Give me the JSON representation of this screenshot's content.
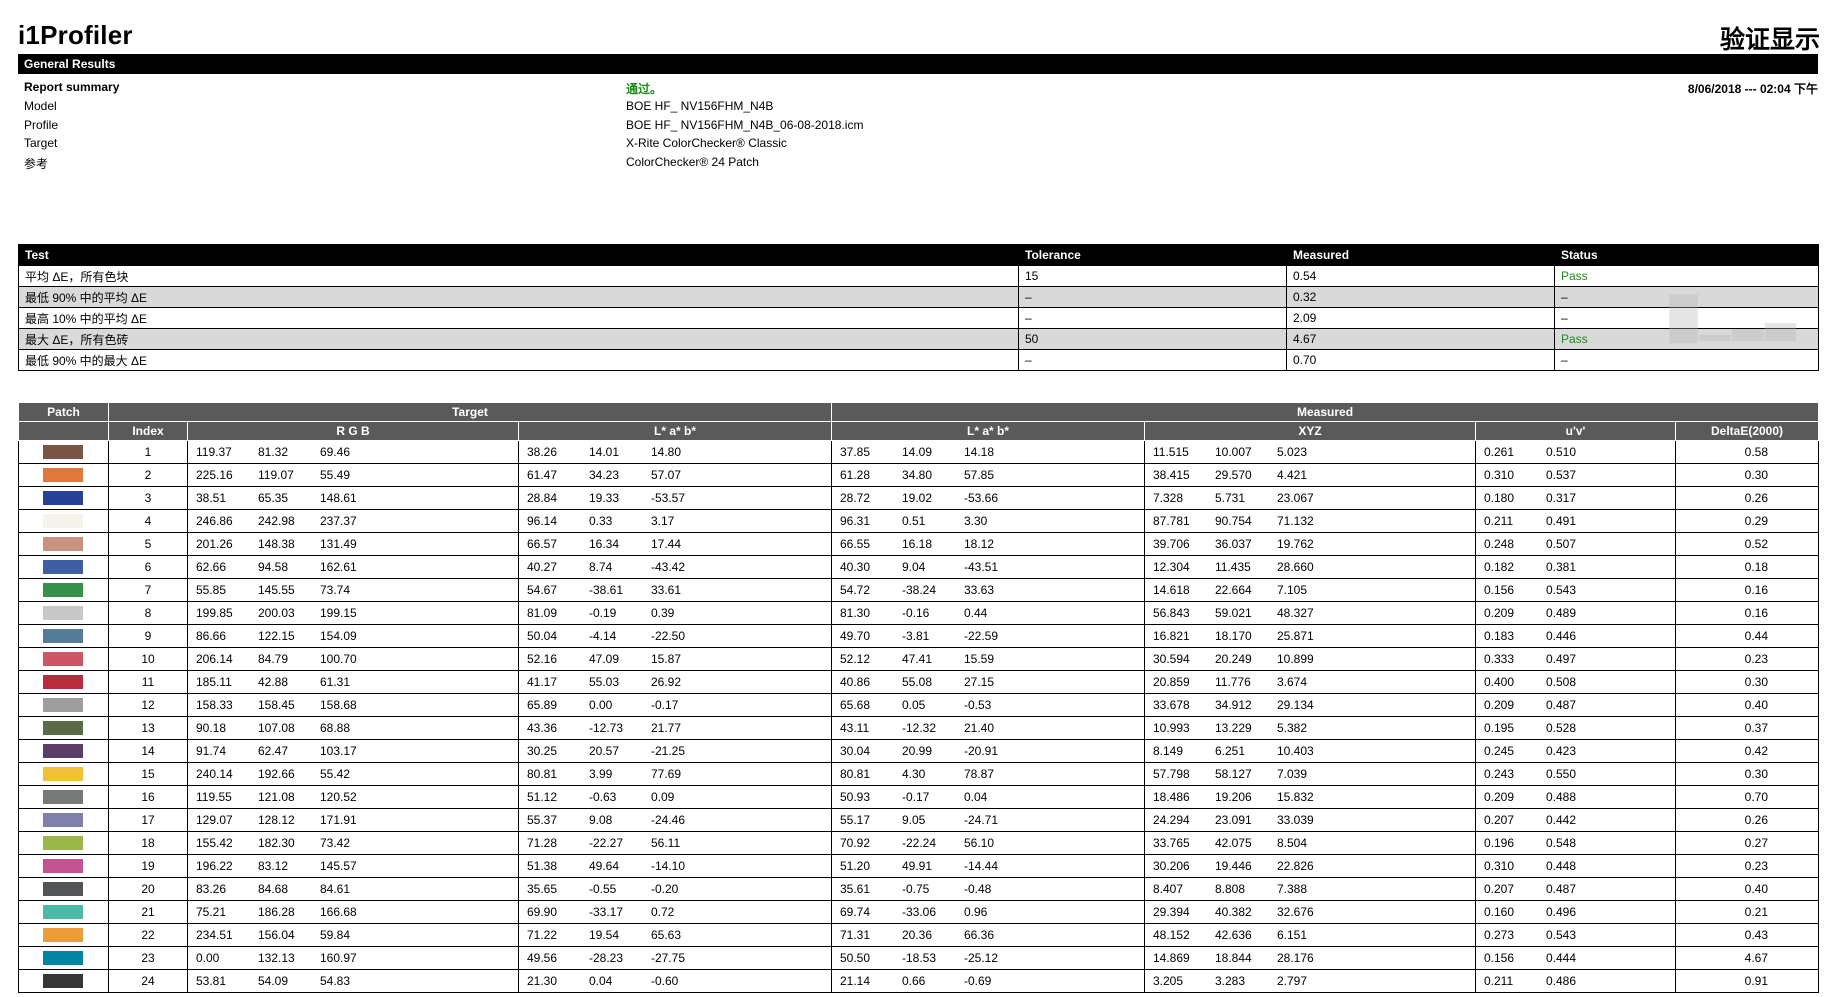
{
  "header": {
    "app_title": "i1Profiler",
    "page_heading": "验证显示"
  },
  "general_results": {
    "bar_title": "General Results",
    "datetime": "8/06/2018 --- 02:04 下午",
    "rows": [
      {
        "label": "Report summary",
        "value": "通过。"
      },
      {
        "label": "Model",
        "value": "BOE HF_ NV156FHM_N4B"
      },
      {
        "label": "Profile",
        "value": "BOE HF_ NV156FHM_N4B_06-08-2018.icm"
      },
      {
        "label": "Target",
        "value": "X-Rite ColorChecker® Classic"
      },
      {
        "label": "参考",
        "value": "ColorChecker® 24 Patch"
      }
    ]
  },
  "test_table": {
    "headers": [
      "Test",
      "Tolerance",
      "Measured",
      "Status"
    ],
    "rows": [
      {
        "test": "平均 ΔE，所有色块",
        "tolerance": "15",
        "measured": "0.54",
        "status": "Pass"
      },
      {
        "test": "最低 90% 中的平均 ΔE",
        "tolerance": "–",
        "measured": "0.32",
        "status": "–"
      },
      {
        "test": "最高 10% 中的平均 ΔE",
        "tolerance": "–",
        "measured": "2.09",
        "status": "–"
      },
      {
        "test": "最大 ΔE，所有色砖",
        "tolerance": "50",
        "measured": "4.67",
        "status": "Pass"
      },
      {
        "test": "最低 90% 中的最大 ΔE",
        "tolerance": "–",
        "measured": "0.70",
        "status": "–"
      }
    ]
  },
  "patch_table": {
    "group_headers": {
      "patch": "Patch",
      "target": "Target",
      "measured": "Measured"
    },
    "sub_headers": {
      "index": "Index",
      "rgb": "R G B",
      "lab_target": "L* a* b*",
      "lab_measured": "L* a* b*",
      "xyz": "XYZ",
      "uv": "u'v'",
      "de": "DeltaE(2000)"
    },
    "rows": [
      {
        "swatch": "#795548",
        "index": "1",
        "rgb": [
          "119.37",
          "81.32",
          "69.46"
        ],
        "tlab": [
          "38.26",
          "14.01",
          "14.80"
        ],
        "mlab": [
          "37.85",
          "14.09",
          "14.18"
        ],
        "xyz": [
          "11.515",
          "10.007",
          "5.023"
        ],
        "uv": [
          "0.261",
          "0.510"
        ],
        "de": "0.58"
      },
      {
        "swatch": "#e1773a",
        "index": "2",
        "rgb": [
          "225.16",
          "119.07",
          "55.49"
        ],
        "tlab": [
          "61.47",
          "34.23",
          "57.07"
        ],
        "mlab": [
          "61.28",
          "34.80",
          "57.85"
        ],
        "xyz": [
          "38.415",
          "29.570",
          "4.421"
        ],
        "uv": [
          "0.310",
          "0.537"
        ],
        "de": "0.30"
      },
      {
        "swatch": "#264195",
        "index": "3",
        "rgb": [
          "38.51",
          "65.35",
          "148.61"
        ],
        "tlab": [
          "28.84",
          "19.33",
          "-53.57"
        ],
        "mlab": [
          "28.72",
          "19.02",
          "-53.66"
        ],
        "xyz": [
          "7.328",
          "5.731",
          "23.067"
        ],
        "uv": [
          "0.180",
          "0.317"
        ],
        "de": "0.26"
      },
      {
        "swatch": "#f6f3ed",
        "index": "4",
        "rgb": [
          "246.86",
          "242.98",
          "237.37"
        ],
        "tlab": [
          "96.14",
          "0.33",
          "3.17"
        ],
        "mlab": [
          "96.31",
          "0.51",
          "3.30"
        ],
        "xyz": [
          "87.781",
          "90.754",
          "71.132"
        ],
        "uv": [
          "0.211",
          "0.491"
        ],
        "de": "0.29"
      },
      {
        "swatch": "#c9947f",
        "index": "5",
        "rgb": [
          "201.26",
          "148.38",
          "131.49"
        ],
        "tlab": [
          "66.57",
          "16.34",
          "17.44"
        ],
        "mlab": [
          "66.55",
          "16.18",
          "18.12"
        ],
        "xyz": [
          "39.706",
          "36.037",
          "19.762"
        ],
        "uv": [
          "0.248",
          "0.507"
        ],
        "de": "0.52"
      },
      {
        "swatch": "#3f5fa3",
        "index": "6",
        "rgb": [
          "62.66",
          "94.58",
          "162.61"
        ],
        "tlab": [
          "40.27",
          "8.74",
          "-43.42"
        ],
        "mlab": [
          "40.30",
          "9.04",
          "-43.51"
        ],
        "xyz": [
          "12.304",
          "11.435",
          "28.660"
        ],
        "uv": [
          "0.182",
          "0.381"
        ],
        "de": "0.18"
      },
      {
        "swatch": "#37914a",
        "index": "7",
        "rgb": [
          "55.85",
          "145.55",
          "73.74"
        ],
        "tlab": [
          "54.67",
          "-38.61",
          "33.61"
        ],
        "mlab": [
          "54.72",
          "-38.24",
          "33.63"
        ],
        "xyz": [
          "14.618",
          "22.664",
          "7.105"
        ],
        "uv": [
          "0.156",
          "0.543"
        ],
        "de": "0.16"
      },
      {
        "swatch": "#c7c8c7",
        "index": "8",
        "rgb": [
          "199.85",
          "200.03",
          "199.15"
        ],
        "tlab": [
          "81.09",
          "-0.19",
          "0.39"
        ],
        "mlab": [
          "81.30",
          "-0.16",
          "0.44"
        ],
        "xyz": [
          "56.843",
          "59.021",
          "48.327"
        ],
        "uv": [
          "0.209",
          "0.489"
        ],
        "de": "0.16"
      },
      {
        "swatch": "#567a9a",
        "index": "9",
        "rgb": [
          "86.66",
          "122.15",
          "154.09"
        ],
        "tlab": [
          "50.04",
          "-4.14",
          "-22.50"
        ],
        "mlab": [
          "49.70",
          "-3.81",
          "-22.59"
        ],
        "xyz": [
          "16.821",
          "18.170",
          "25.871"
        ],
        "uv": [
          "0.183",
          "0.446"
        ],
        "de": "0.44"
      },
      {
        "swatch": "#ce5565",
        "index": "10",
        "rgb": [
          "206.14",
          "84.79",
          "100.70"
        ],
        "tlab": [
          "52.16",
          "47.09",
          "15.87"
        ],
        "mlab": [
          "52.12",
          "47.41",
          "15.59"
        ],
        "xyz": [
          "30.594",
          "20.249",
          "10.899"
        ],
        "uv": [
          "0.333",
          "0.497"
        ],
        "de": "0.23"
      },
      {
        "swatch": "#b92b3d",
        "index": "11",
        "rgb": [
          "185.11",
          "42.88",
          "61.31"
        ],
        "tlab": [
          "41.17",
          "55.03",
          "26.92"
        ],
        "mlab": [
          "40.86",
          "55.08",
          "27.15"
        ],
        "xyz": [
          "20.859",
          "11.776",
          "3.674"
        ],
        "uv": [
          "0.400",
          "0.508"
        ],
        "de": "0.30"
      },
      {
        "swatch": "#9e9e9e",
        "index": "12",
        "rgb": [
          "158.33",
          "158.45",
          "158.68"
        ],
        "tlab": [
          "65.89",
          "0.00",
          "-0.17"
        ],
        "mlab": [
          "65.68",
          "0.05",
          "-0.53"
        ],
        "xyz": [
          "33.678",
          "34.912",
          "29.134"
        ],
        "uv": [
          "0.209",
          "0.487"
        ],
        "de": "0.40"
      },
      {
        "swatch": "#5a6b45",
        "index": "13",
        "rgb": [
          "90.18",
          "107.08",
          "68.88"
        ],
        "tlab": [
          "43.36",
          "-12.73",
          "21.77"
        ],
        "mlab": [
          "43.11",
          "-12.32",
          "21.40"
        ],
        "xyz": [
          "10.993",
          "13.229",
          "5.382"
        ],
        "uv": [
          "0.195",
          "0.528"
        ],
        "de": "0.37"
      },
      {
        "swatch": "#5b3e67",
        "index": "14",
        "rgb": [
          "91.74",
          "62.47",
          "103.17"
        ],
        "tlab": [
          "30.25",
          "20.57",
          "-21.25"
        ],
        "mlab": [
          "30.04",
          "20.99",
          "-20.91"
        ],
        "xyz": [
          "8.149",
          "6.251",
          "10.403"
        ],
        "uv": [
          "0.245",
          "0.423"
        ],
        "de": "0.42"
      },
      {
        "swatch": "#f0c137",
        "index": "15",
        "rgb": [
          "240.14",
          "192.66",
          "55.42"
        ],
        "tlab": [
          "80.81",
          "3.99",
          "77.69"
        ],
        "mlab": [
          "80.81",
          "4.30",
          "78.87"
        ],
        "xyz": [
          "57.798",
          "58.127",
          "7.039"
        ],
        "uv": [
          "0.243",
          "0.550"
        ],
        "de": "0.30"
      },
      {
        "swatch": "#777978",
        "index": "16",
        "rgb": [
          "119.55",
          "121.08",
          "120.52"
        ],
        "tlab": [
          "51.12",
          "-0.63",
          "0.09"
        ],
        "mlab": [
          "50.93",
          "-0.17",
          "0.04"
        ],
        "xyz": [
          "18.486",
          "19.206",
          "15.832"
        ],
        "uv": [
          "0.209",
          "0.488"
        ],
        "de": "0.70"
      },
      {
        "swatch": "#8180ac",
        "index": "17",
        "rgb": [
          "129.07",
          "128.12",
          "171.91"
        ],
        "tlab": [
          "55.37",
          "9.08",
          "-24.46"
        ],
        "mlab": [
          "55.17",
          "9.05",
          "-24.71"
        ],
        "xyz": [
          "24.294",
          "23.091",
          "33.039"
        ],
        "uv": [
          "0.207",
          "0.442"
        ],
        "de": "0.26"
      },
      {
        "swatch": "#9bb649",
        "index": "18",
        "rgb": [
          "155.42",
          "182.30",
          "73.42"
        ],
        "tlab": [
          "71.28",
          "-22.27",
          "56.11"
        ],
        "mlab": [
          "70.92",
          "-22.24",
          "56.10"
        ],
        "xyz": [
          "33.765",
          "42.075",
          "8.504"
        ],
        "uv": [
          "0.196",
          "0.548"
        ],
        "de": "0.27"
      },
      {
        "swatch": "#c45392",
        "index": "19",
        "rgb": [
          "196.22",
          "83.12",
          "145.57"
        ],
        "tlab": [
          "51.38",
          "49.64",
          "-14.10"
        ],
        "mlab": [
          "51.20",
          "49.91",
          "-14.44"
        ],
        "xyz": [
          "30.206",
          "19.446",
          "22.826"
        ],
        "uv": [
          "0.310",
          "0.448"
        ],
        "de": "0.23"
      },
      {
        "swatch": "#535455",
        "index": "20",
        "rgb": [
          "83.26",
          "84.68",
          "84.61"
        ],
        "tlab": [
          "35.65",
          "-0.55",
          "-0.20"
        ],
        "mlab": [
          "35.61",
          "-0.75",
          "-0.48"
        ],
        "xyz": [
          "8.407",
          "8.808",
          "7.388"
        ],
        "uv": [
          "0.207",
          "0.487"
        ],
        "de": "0.40"
      },
      {
        "swatch": "#4bbaa7",
        "index": "21",
        "rgb": [
          "75.21",
          "186.28",
          "166.68"
        ],
        "tlab": [
          "69.90",
          "-33.17",
          "0.72"
        ],
        "mlab": [
          "69.74",
          "-33.06",
          "0.96"
        ],
        "xyz": [
          "29.394",
          "40.382",
          "32.676"
        ],
        "uv": [
          "0.160",
          "0.496"
        ],
        "de": "0.21"
      },
      {
        "swatch": "#eb9c3b",
        "index": "22",
        "rgb": [
          "234.51",
          "156.04",
          "59.84"
        ],
        "tlab": [
          "71.22",
          "19.54",
          "65.63"
        ],
        "mlab": [
          "71.31",
          "20.36",
          "66.36"
        ],
        "xyz": [
          "48.152",
          "42.636",
          "6.151"
        ],
        "uv": [
          "0.273",
          "0.543"
        ],
        "de": "0.43"
      },
      {
        "swatch": "#0084a1",
        "index": "23",
        "rgb": [
          "0.00",
          "132.13",
          "160.97"
        ],
        "tlab": [
          "49.56",
          "-28.23",
          "-27.75"
        ],
        "mlab": [
          "50.50",
          "-18.53",
          "-25.12"
        ],
        "xyz": [
          "14.869",
          "18.844",
          "28.176"
        ],
        "uv": [
          "0.156",
          "0.444"
        ],
        "de": "4.67"
      },
      {
        "swatch": "#363637",
        "index": "24",
        "rgb": [
          "53.81",
          "54.09",
          "54.83"
        ],
        "tlab": [
          "21.30",
          "0.04",
          "-0.60"
        ],
        "mlab": [
          "21.14",
          "0.66",
          "-0.69"
        ],
        "xyz": [
          "3.205",
          "3.283",
          "2.797"
        ],
        "uv": [
          "0.211",
          "0.486"
        ],
        "de": "0.91"
      }
    ]
  },
  "colors": {
    "header_bar": "#000000",
    "patch_header": "#5a5a5a",
    "pass_text": "#1f8a1f",
    "alt_row": "#d9d9d9"
  }
}
